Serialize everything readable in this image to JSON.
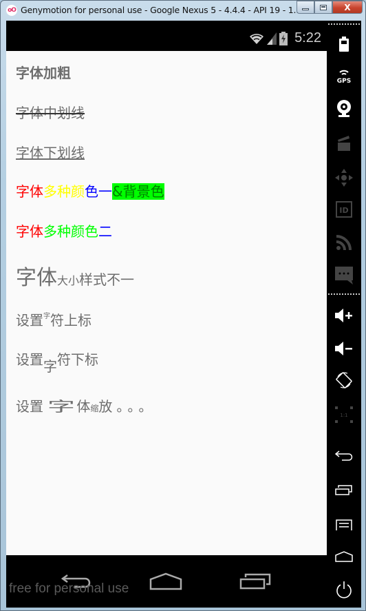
{
  "window": {
    "title": "Genymotion for personal use - Google Nexus 5 - 4.4.4 - API 19 - 1...",
    "app_icon_text": "oO",
    "buttons": {
      "minimize": "minimize",
      "maximize": "maximize",
      "close": "X"
    }
  },
  "statusbar": {
    "time": "5:22",
    "icons": [
      "wifi-icon",
      "signal-icon",
      "battery-charging-icon"
    ]
  },
  "content": {
    "bold_text": "字体加粗",
    "strikethrough_text": "字体中划线",
    "underline_text": "字体下划线",
    "multicolor1": [
      {
        "text": "字体",
        "color": "#ff0000"
      },
      {
        "text": "多种颜",
        "color": "#ffff00"
      },
      {
        "text": "色一",
        "color": "#0000ff"
      },
      {
        "text": "&背景色",
        "color": "#008000",
        "background": "#00ff00"
      }
    ],
    "multicolor2": [
      {
        "text": "字体",
        "color": "#ff0000"
      },
      {
        "text": "多种颜色",
        "color": "#00ff00"
      },
      {
        "text": "二",
        "color": "#0000ff"
      }
    ],
    "size_style": {
      "big": "字体",
      "small": "大小",
      "rest": "样式不一"
    },
    "superscript": {
      "before": "设置",
      "sup": "字",
      "after": "符上标"
    },
    "subscript": {
      "before": "设置",
      "sub": "字",
      "after": "符下标"
    },
    "scale": {
      "before": "设置",
      "wide": "字",
      "normal": "体",
      "narrow": "缩",
      "after": "放。。。"
    }
  },
  "navbar": {
    "back": "back",
    "home": "home",
    "recents": "recents",
    "watermark": "free for personal use"
  },
  "sidebar": {
    "items": [
      {
        "name": "battery-icon",
        "enabled": true
      },
      {
        "name": "gps-icon",
        "label": "GPS",
        "enabled": true
      },
      {
        "name": "webcam-icon",
        "enabled": true
      },
      {
        "name": "screencast-icon",
        "enabled": false
      },
      {
        "name": "dpad-icon",
        "enabled": false
      },
      {
        "name": "device-id-icon",
        "label": "ID",
        "enabled": false
      },
      {
        "name": "network-icon",
        "enabled": false
      },
      {
        "name": "sms-icon",
        "enabled": false
      },
      {
        "name": "volume-up-icon",
        "enabled": true
      },
      {
        "name": "volume-down-icon",
        "enabled": true
      },
      {
        "name": "rotate-icon",
        "enabled": true
      },
      {
        "name": "pixel-perfect-icon",
        "label": "1:1",
        "enabled": false
      },
      {
        "name": "back-icon",
        "enabled": true
      },
      {
        "name": "recent-apps-icon",
        "enabled": true
      },
      {
        "name": "menu-icon",
        "enabled": true
      },
      {
        "name": "home-icon",
        "enabled": true
      },
      {
        "name": "power-icon",
        "enabled": true
      }
    ]
  }
}
